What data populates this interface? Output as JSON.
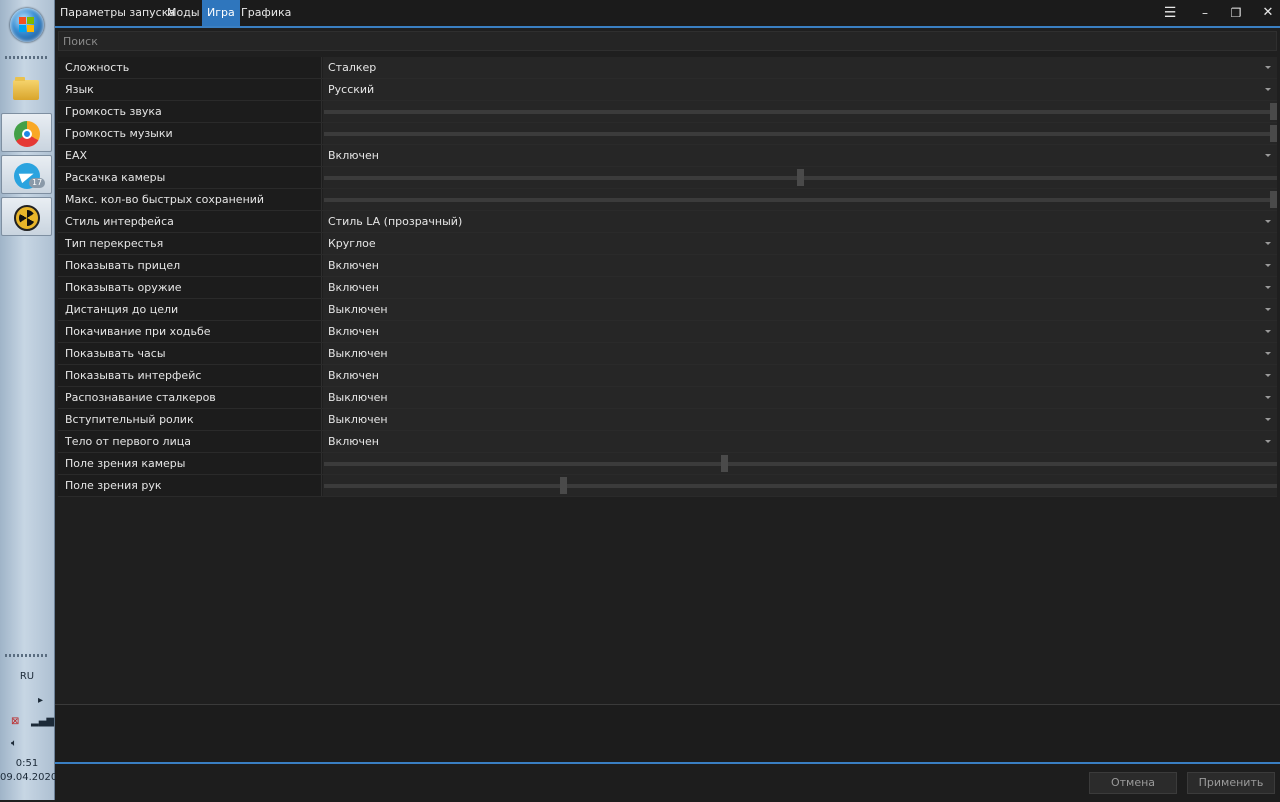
{
  "taskbar": {
    "start_icon": "windows-start-orb",
    "apps": [
      {
        "name": "file-explorer",
        "icon": "folder-icon"
      },
      {
        "name": "chrome",
        "icon": "chrome-icon"
      },
      {
        "name": "telegram",
        "icon": "telegram-icon",
        "badge": "17"
      },
      {
        "name": "stalker-launcher",
        "icon": "radiation-icon"
      }
    ],
    "language": "RU",
    "time": "0:51",
    "date": "09.04.2020"
  },
  "menu": {
    "items": [
      "Параметры запуска",
      "Моды",
      "Игра",
      "Графика"
    ],
    "active": "Игра",
    "accent_color": "#2f76bd"
  },
  "search": {
    "placeholder": "Поиск"
  },
  "settings": [
    {
      "label": "Сложность",
      "type": "select",
      "value": "Сталкер"
    },
    {
      "label": "Язык",
      "type": "select",
      "value": "Русский"
    },
    {
      "label": "Громкость звука",
      "type": "slider",
      "level": 1.0
    },
    {
      "label": "Громкость музыки",
      "type": "slider",
      "level": 1.0
    },
    {
      "label": "EAX",
      "type": "select",
      "value": "Включен"
    },
    {
      "label": "Раскачка камеры",
      "type": "slider",
      "level": 0.5
    },
    {
      "label": "Макс. кол-во быстрых сохранений",
      "type": "slider",
      "level": 1.0
    },
    {
      "label": "Стиль интерфейса",
      "type": "select",
      "value": "Стиль LA (прозрачный)"
    },
    {
      "label": "Тип перекрестья",
      "type": "select",
      "value": "Круглое"
    },
    {
      "label": "Показывать прицел",
      "type": "select",
      "value": "Включен"
    },
    {
      "label": "Показывать оружие",
      "type": "select",
      "value": "Включен"
    },
    {
      "label": "Дистанция до цели",
      "type": "select",
      "value": "Выключен"
    },
    {
      "label": "Покачивание при ходьбе",
      "type": "select",
      "value": "Включен"
    },
    {
      "label": "Показывать часы",
      "type": "select",
      "value": "Выключен"
    },
    {
      "label": "Показывать интерфейс",
      "type": "select",
      "value": "Включен"
    },
    {
      "label": "Распознавание сталкеров",
      "type": "select",
      "value": "Выключен"
    },
    {
      "label": "Вступительный ролик",
      "type": "select",
      "value": "Выключен"
    },
    {
      "label": "Тело от первого лица",
      "type": "select",
      "value": "Включен"
    },
    {
      "label": "Поле зрения камеры",
      "type": "slider",
      "level": 0.42
    },
    {
      "label": "Поле зрения рук",
      "type": "slider",
      "level": 0.25
    }
  ],
  "footer": {
    "cancel_label": "Отмена",
    "apply_label": "Применить"
  }
}
